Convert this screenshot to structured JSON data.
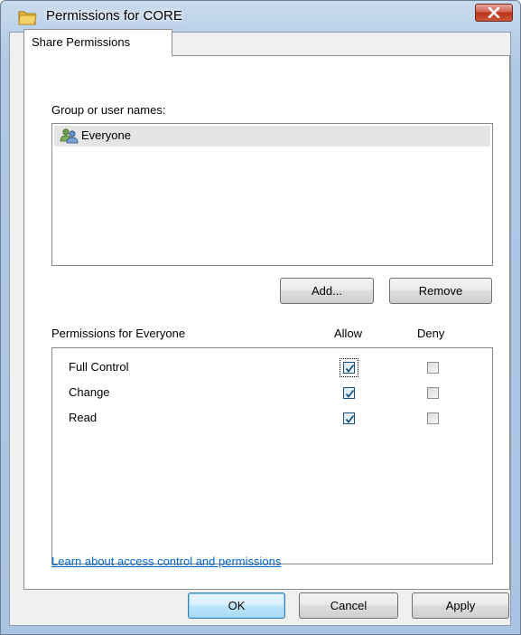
{
  "window": {
    "title": "Permissions for CORE"
  },
  "tabs": [
    {
      "label": "Share Permissions",
      "active": true
    }
  ],
  "group_section": {
    "label": "Group or user names:",
    "users": [
      {
        "name": "Everyone",
        "icon": "user-group-icon",
        "selected": true
      }
    ],
    "add_label": "Add...",
    "remove_label": "Remove"
  },
  "permissions": {
    "header": "Permissions for Everyone",
    "allow_header": "Allow",
    "deny_header": "Deny",
    "rows": [
      {
        "name": "Full Control",
        "allow": true,
        "deny": false
      },
      {
        "name": "Change",
        "allow": true,
        "deny": false
      },
      {
        "name": "Read",
        "allow": true,
        "deny": false
      }
    ]
  },
  "help_link": "Learn about access control and permissions",
  "footer": {
    "ok_label": "OK",
    "cancel_label": "Cancel",
    "apply_label": "Apply"
  },
  "colors": {
    "link": "#0066cc",
    "selected_row": "#e5e5e5",
    "check": "#1c5180"
  }
}
